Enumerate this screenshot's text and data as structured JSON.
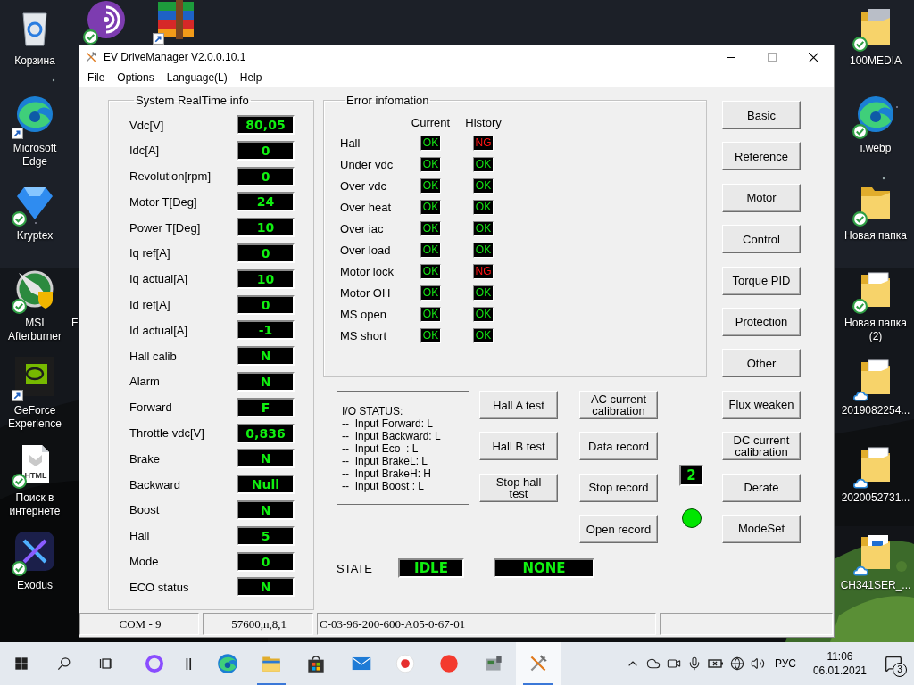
{
  "desktop": {
    "left_icons": [
      {
        "label": "Корзина",
        "kind": "recycle",
        "synced": false,
        "cloud": false,
        "shortcut": false
      },
      {
        "label": "Microsoft Edge",
        "kind": "edge",
        "synced": false,
        "cloud": false,
        "shortcut": true
      },
      {
        "label": "Kryptex",
        "kind": "kryptex",
        "synced": true,
        "cloud": false,
        "shortcut": false
      },
      {
        "label": "MSI Afterburner",
        "kind": "msi",
        "synced": true,
        "cloud": false,
        "shortcut": false
      },
      {
        "label": "GeForce Experience",
        "kind": "geforce",
        "synced": false,
        "cloud": false,
        "shortcut": true
      },
      {
        "label": "Поиск в интернете",
        "kind": "html",
        "synced": true,
        "cloud": false,
        "shortcut": false,
        "icon_text": "HTML"
      },
      {
        "label": "Exodus",
        "kind": "exodus",
        "synced": true,
        "cloud": false,
        "shortcut": false
      }
    ],
    "top_icons": [
      {
        "kind": "tor",
        "synced": true,
        "cloud": false,
        "shortcut": false
      },
      {
        "kind": "winrar",
        "synced": false,
        "cloud": false,
        "shortcut": true
      }
    ],
    "covered_label": "F",
    "right_icons": [
      {
        "label": "100MEDIA",
        "kind": "folder-photo",
        "synced": true,
        "cloud": false,
        "shortcut": false
      },
      {
        "label": "i.webp",
        "kind": "edge",
        "synced": true,
        "cloud": false,
        "shortcut": false
      },
      {
        "label": "Новая папка",
        "kind": "folder",
        "synced": true,
        "cloud": false,
        "shortcut": false
      },
      {
        "label": "Новая папка (2)",
        "kind": "folder-docs",
        "synced": true,
        "cloud": false,
        "shortcut": false
      },
      {
        "label": "2019082254...",
        "kind": "folder-docs",
        "synced": false,
        "cloud": true,
        "shortcut": false
      },
      {
        "label": "2020052731...",
        "kind": "folder-docs",
        "synced": false,
        "cloud": true,
        "shortcut": false
      },
      {
        "label": "CH341SER_...",
        "kind": "folder-blue",
        "synced": false,
        "cloud": true,
        "shortcut": false
      }
    ]
  },
  "window": {
    "title": "EV DriveManager V2.0.0.10.1",
    "menu": [
      "File",
      "Options",
      "Language(L)",
      "Help"
    ]
  },
  "realtime": {
    "title": "System RealTime info",
    "rows": [
      {
        "label": "Vdc[V]",
        "value": "80,05"
      },
      {
        "label": "Idc[A]",
        "value": "0"
      },
      {
        "label": "Revolution[rpm]",
        "value": "0"
      },
      {
        "label": "Motor T[Deg]",
        "value": "24"
      },
      {
        "label": "Power T[Deg]",
        "value": "10"
      },
      {
        "label": "Iq ref[A]",
        "value": "0"
      },
      {
        "label": "Iq actual[A]",
        "value": "10"
      },
      {
        "label": "Id ref[A]",
        "value": "0"
      },
      {
        "label": "Id actual[A]",
        "value": "-1"
      },
      {
        "label": "Hall calib",
        "value": "N"
      },
      {
        "label": "Alarm",
        "value": "N"
      },
      {
        "label": "Forward",
        "value": "F"
      },
      {
        "label": "Throttle vdc[V]",
        "value": "0,836"
      },
      {
        "label": "Brake",
        "value": "N"
      },
      {
        "label": "Backward",
        "value": "Null"
      },
      {
        "label": "Boost",
        "value": "N"
      },
      {
        "label": "Hall",
        "value": "5"
      },
      {
        "label": "Mode",
        "value": "0"
      },
      {
        "label": "ECO status",
        "value": "N"
      }
    ]
  },
  "errors": {
    "title": "Error infomation",
    "columns": [
      "Current",
      "History"
    ],
    "rows": [
      {
        "label": "Hall",
        "current": {
          "text": "OK",
          "fault": false
        },
        "history": {
          "text": "NG",
          "fault": true
        }
      },
      {
        "label": "Under vdc",
        "current": {
          "text": "OK",
          "fault": false
        },
        "history": {
          "text": "OK",
          "fault": false
        }
      },
      {
        "label": "Over vdc",
        "current": {
          "text": "OK",
          "fault": false
        },
        "history": {
          "text": "OK",
          "fault": false
        }
      },
      {
        "label": "Over heat",
        "current": {
          "text": "OK",
          "fault": false
        },
        "history": {
          "text": "OK",
          "fault": false
        }
      },
      {
        "label": "Over iac",
        "current": {
          "text": "OK",
          "fault": false
        },
        "history": {
          "text": "OK",
          "fault": false
        }
      },
      {
        "label": "Over load",
        "current": {
          "text": "OK",
          "fault": false
        },
        "history": {
          "text": "OK",
          "fault": false
        }
      },
      {
        "label": "Motor lock",
        "current": {
          "text": "OK",
          "fault": false
        },
        "history": {
          "text": "NG",
          "fault": true
        }
      },
      {
        "label": "Motor OH",
        "current": {
          "text": "OK",
          "fault": false
        },
        "history": {
          "text": "OK",
          "fault": false
        }
      },
      {
        "label": "MS open",
        "current": {
          "text": "OK",
          "fault": false
        },
        "history": {
          "text": "OK",
          "fault": false
        }
      },
      {
        "label": "MS short",
        "current": {
          "text": "OK",
          "fault": false
        },
        "history": {
          "text": "OK",
          "fault": false
        }
      }
    ]
  },
  "io_status": {
    "lines": [
      "I/O STATUS:",
      "--  Input Forward: L",
      "--  Input Backward: L",
      "--  Input Eco  : L",
      "--  Input BrakeL: L",
      "--  Input BrakeH: H",
      "--  Input Boost : L"
    ]
  },
  "test_buttons": [
    "Hall A test",
    "Hall B test",
    "Stop hall test"
  ],
  "record_buttons": [
    "AC current calibration",
    "Data record",
    "Stop record",
    "Open record"
  ],
  "counter": "2",
  "indicator": {
    "on": true
  },
  "state": {
    "label": "STATE",
    "mode": "IDLE",
    "detail": "NONE"
  },
  "side_buttons": [
    "Basic",
    "Reference",
    "Motor",
    "Control",
    "Torque PID",
    "Protection",
    "Other",
    "Flux weaken",
    "DC current calibration",
    "Derate",
    "ModeSet"
  ],
  "status_bar": [
    "COM - 9",
    "57600,n,8,1",
    "C-03-96-200-600-A05-0-67-01"
  ],
  "taskbar": {
    "buttons": [
      {
        "kind": "start"
      },
      {
        "kind": "search"
      },
      {
        "kind": "task-view"
      }
    ],
    "apps": [
      {
        "kind": "alice",
        "running": false,
        "selected": false
      },
      {
        "kind": "bars",
        "running": false,
        "selected": false
      },
      {
        "kind": "edge",
        "running": false,
        "selected": false
      },
      {
        "kind": "explorer",
        "running": true,
        "selected": false
      },
      {
        "kind": "store",
        "running": false,
        "selected": false
      },
      {
        "kind": "mail",
        "running": false,
        "selected": false
      },
      {
        "kind": "yandex-browser",
        "running": false,
        "selected": false
      },
      {
        "kind": "yandex",
        "running": false,
        "selected": false
      },
      {
        "kind": "device",
        "running": false,
        "selected": false
      },
      {
        "kind": "tools",
        "running": true,
        "selected": true
      }
    ],
    "tray": [
      {
        "kind": "chevron"
      },
      {
        "kind": "cloud"
      },
      {
        "kind": "camera"
      },
      {
        "kind": "mic"
      },
      {
        "kind": "battery"
      },
      {
        "kind": "globe"
      },
      {
        "kind": "volume"
      }
    ],
    "language": "РУС",
    "time": "11:06",
    "date": "06.01.2021",
    "notification_count": "3"
  }
}
